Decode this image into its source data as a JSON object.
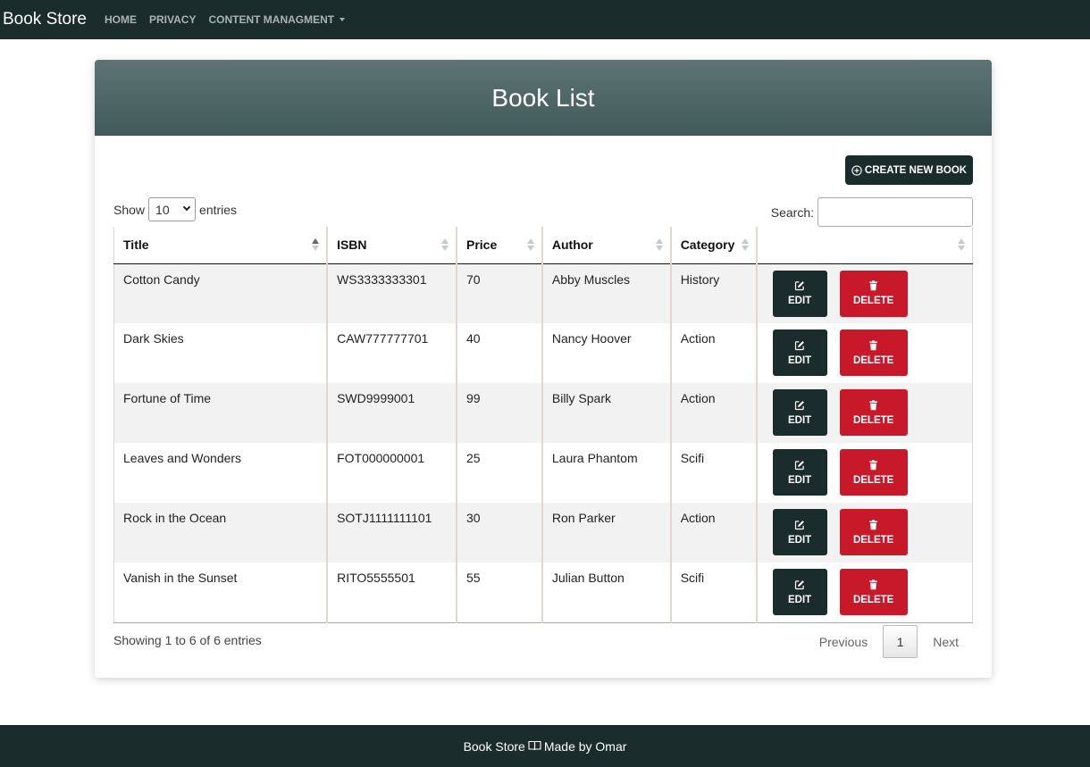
{
  "navbar": {
    "brand": "Book Store",
    "links": [
      {
        "label": "HOME"
      },
      {
        "label": "PRIVACY"
      },
      {
        "label": "CONTENT MANAGMENT"
      }
    ]
  },
  "card": {
    "title": "Book List",
    "create_button": "CREATE NEW BOOK",
    "length": {
      "show": "Show",
      "value": "10",
      "entries": "entries"
    },
    "search": {
      "label": "Search:",
      "value": ""
    },
    "table": {
      "headers": [
        "Title",
        "ISBN",
        "Price",
        "Author",
        "Category",
        ""
      ],
      "rows": [
        {
          "title": "Cotton Candy",
          "isbn": "WS3333333301",
          "price": "70",
          "author": "Abby Muscles",
          "category": "History"
        },
        {
          "title": "Dark Skies",
          "isbn": "CAW777777701",
          "price": "40",
          "author": "Nancy Hoover",
          "category": "Action"
        },
        {
          "title": "Fortune of Time",
          "isbn": "SWD9999001",
          "price": "99",
          "author": "Billy Spark",
          "category": "Action"
        },
        {
          "title": "Leaves and Wonders",
          "isbn": "FOT000000001",
          "price": "25",
          "author": "Laura Phantom",
          "category": "Scifi"
        },
        {
          "title": "Rock in the Ocean",
          "isbn": "SOTJ1111111101",
          "price": "30",
          "author": "Ron Parker",
          "category": "Action"
        },
        {
          "title": "Vanish in the Sunset",
          "isbn": "RITO5555501",
          "price": "55",
          "author": "Julian Button",
          "category": "Scifi"
        }
      ],
      "edit_label": "EDIT",
      "delete_label": "DELETE"
    },
    "info": "Showing 1 to 6 of 6 entries",
    "pagination": {
      "previous": "Previous",
      "current": "1",
      "next": "Next"
    }
  },
  "footer": {
    "text_left": "Book Store",
    "text_right": "Made by Omar"
  },
  "colors": {
    "dark": "#1b2c2c",
    "danger": "#c8192a",
    "header_gradient_top": "#5e7474",
    "header_gradient_bottom": "#415a5a"
  },
  "icons": {
    "create": "plus-circle-icon",
    "edit": "pencil-square-icon",
    "delete": "trash-icon",
    "footer": "book-icon"
  }
}
